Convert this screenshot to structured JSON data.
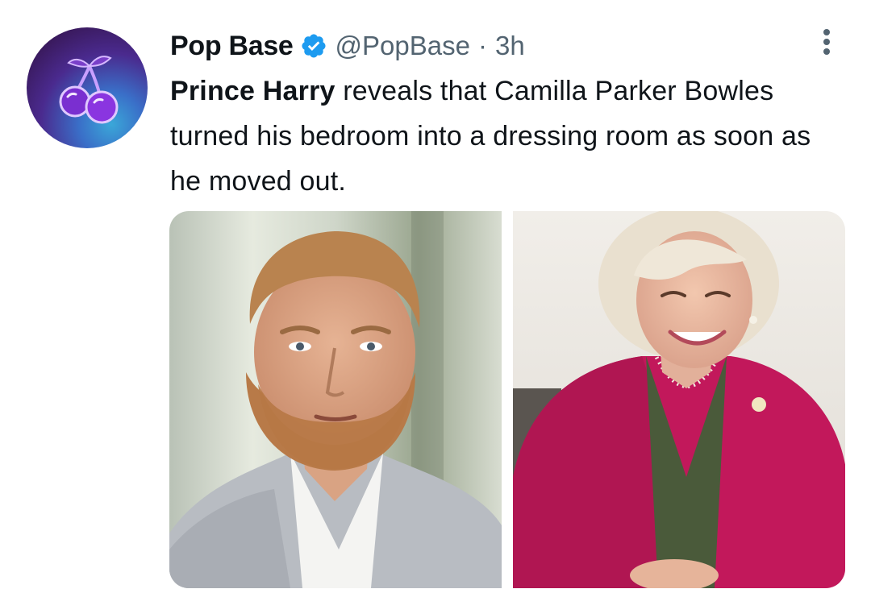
{
  "tweet": {
    "display_name": "Pop Base",
    "verified": true,
    "handle": "@PopBase",
    "separator": "·",
    "time": "3h",
    "text_bold": "Prince Harry",
    "text_rest": " reveals that Camilla Parker Bowles turned his bedroom into a dressing room as soon as he moved out."
  },
  "icons": {
    "avatar": "cherry-icon",
    "verified": "verified-badge-icon",
    "more": "more-vertical-icon"
  },
  "colors": {
    "text": "#0f1419",
    "secondary_text": "#536471",
    "verified_blue": "#1d9bf0",
    "avatar_purple": "#3a1a5e"
  }
}
